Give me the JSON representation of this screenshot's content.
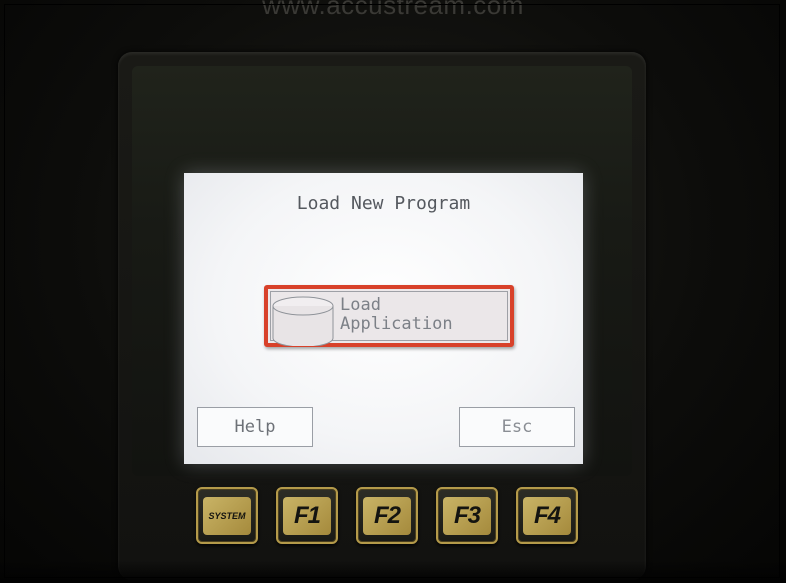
{
  "header": {
    "url": "www.accustream.com"
  },
  "screen": {
    "title": "Load New Program",
    "load_application": {
      "label": "Load\nApplication",
      "icon": "database-icon"
    },
    "help_label": "Help",
    "esc_label": "Esc"
  },
  "function_keys": {
    "system": "SYSTEM",
    "f1": "F1",
    "f2": "F2",
    "f3": "F3",
    "f4": "F4"
  },
  "colors": {
    "highlight": "#d8412a",
    "key_gold": "#b49a4a",
    "lcd_background": "#f4f5f7"
  }
}
